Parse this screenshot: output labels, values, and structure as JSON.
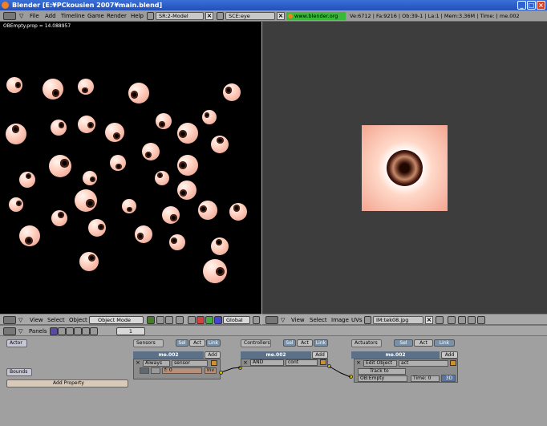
{
  "window": {
    "title": "Blender [E:¥PCkousien 2007¥main.blend]"
  },
  "header": {
    "menu": [
      "File",
      "Add",
      "Timeline",
      "Game",
      "Render",
      "Help"
    ],
    "screen": "SR:2-Model",
    "scene": "SCE:eye",
    "url": "www.blender.org 242",
    "stats": "Ve:6712 | Fa:9216 | Ob:39-1 | La:1  | Mem:3.36M  | Time:  | me.002"
  },
  "viewport3d": {
    "overlay": "OBEmpty.prop = 14.088957",
    "menu": [
      "View",
      "Select",
      "Object"
    ],
    "mode": "Object Mode",
    "orientation": "Global"
  },
  "imageeditor": {
    "menu": [
      "View",
      "Select",
      "Image",
      "UVs"
    ],
    "image": "IM:tek08.jpg"
  },
  "buttons": {
    "panels_label": "Panels",
    "frame": "1"
  },
  "logic": {
    "actor": "Actor",
    "bounds": "Bounds",
    "add_property": "Add Property",
    "sel": "Sel",
    "act": "Act",
    "link": "Link",
    "add": "Add",
    "sensors": {
      "title": "Sensors",
      "object": "me.002",
      "type": "Always",
      "name": "sensor",
      "f": "f: 0",
      "inv": "Inv"
    },
    "controllers": {
      "title": "Controllers",
      "object": "me.002",
      "type": "AND",
      "name": "cont"
    },
    "actuators": {
      "title": "Actuators",
      "object": "me.002",
      "type": "Edit Object",
      "name": "act",
      "mode": "Track to",
      "ob": "OB:Empty",
      "time": "Time: 0",
      "three_d": "3D"
    }
  }
}
